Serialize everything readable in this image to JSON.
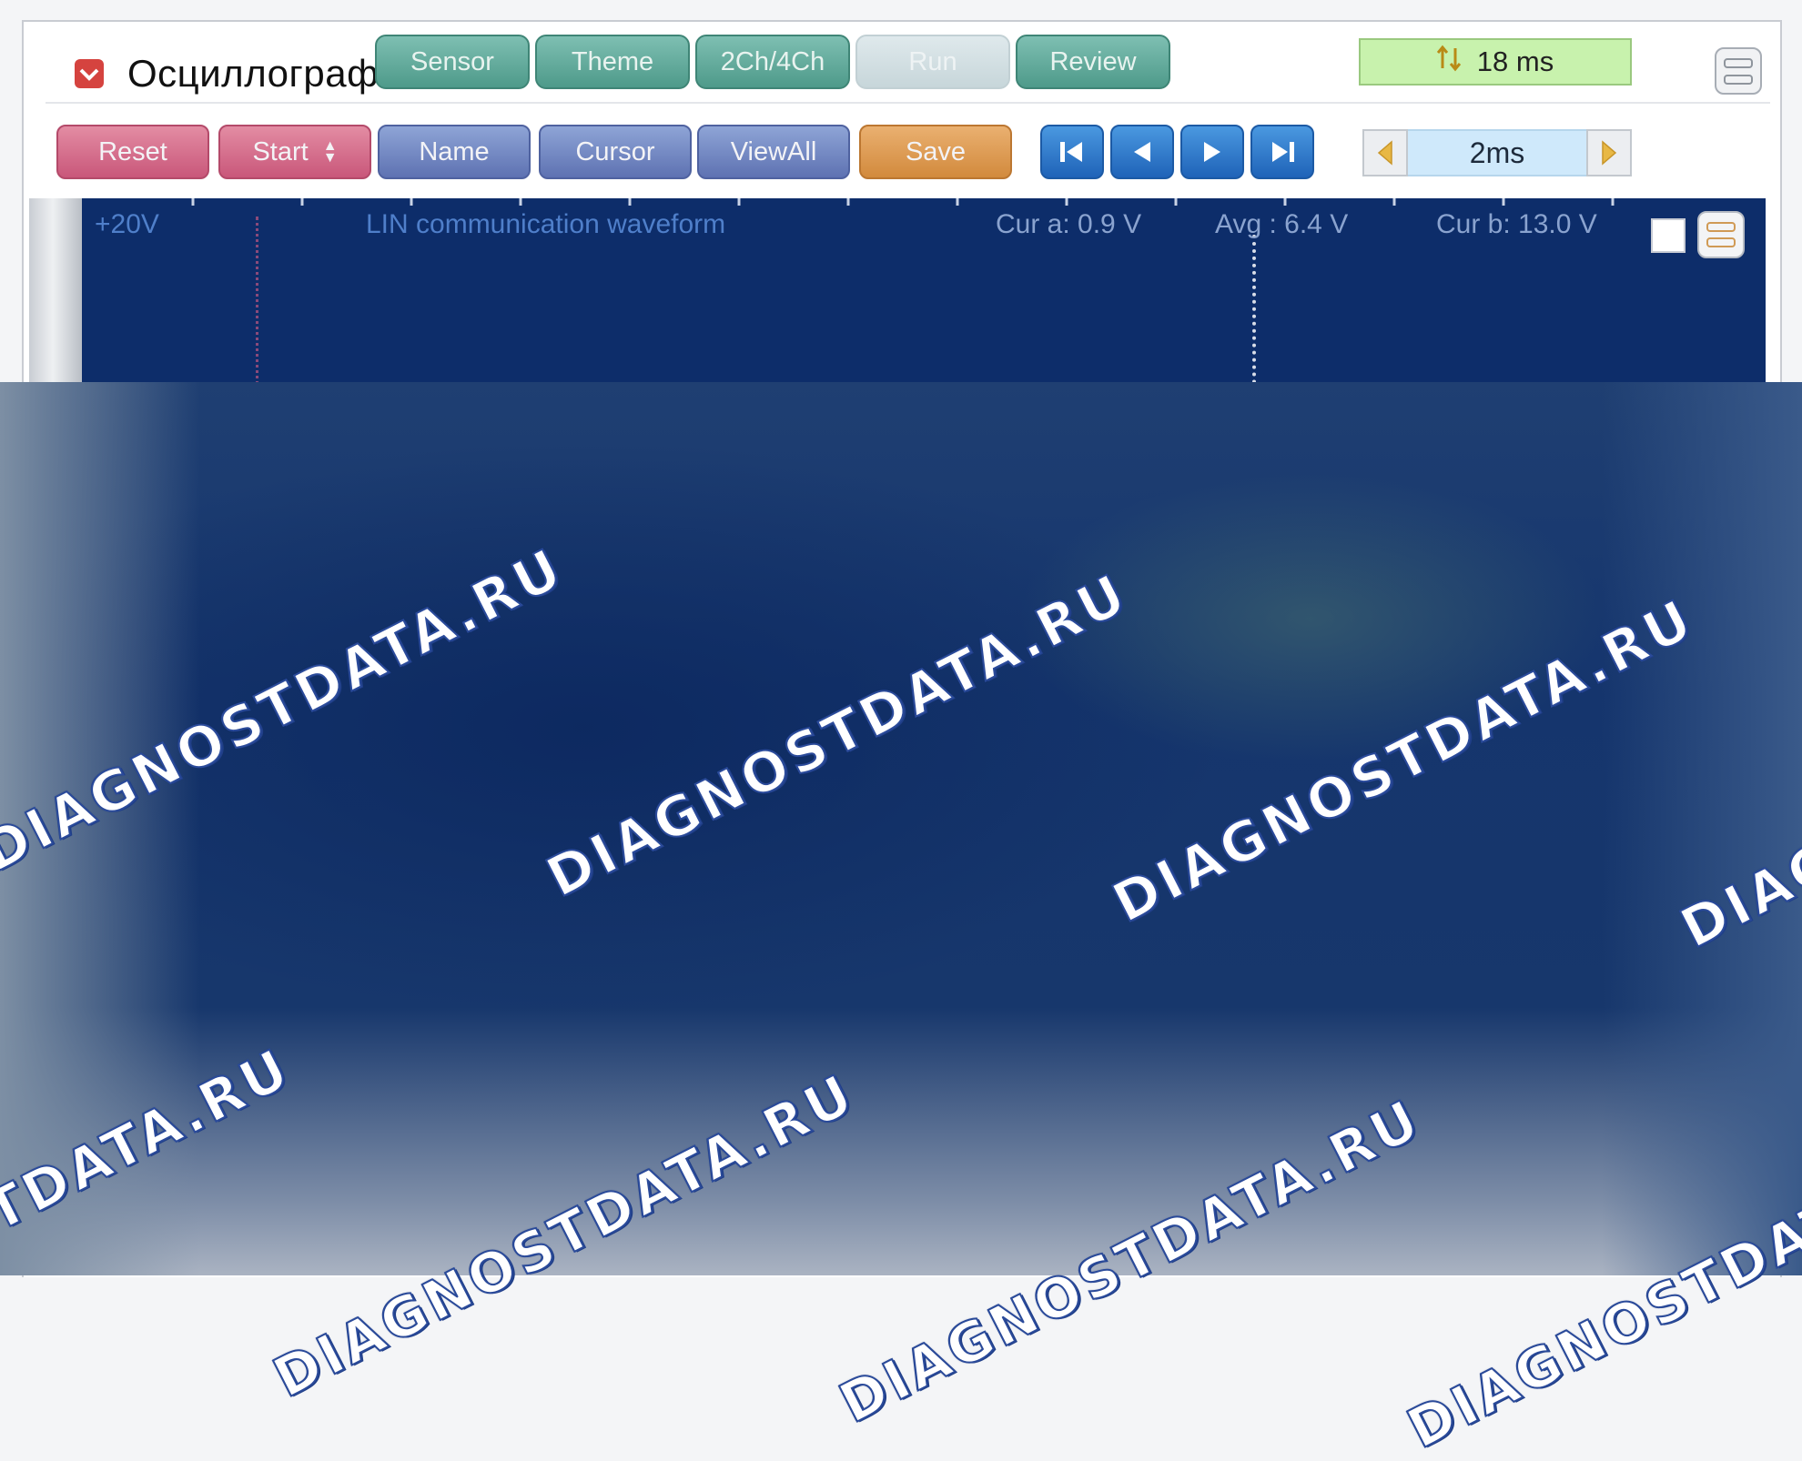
{
  "app": {
    "title": "Осциллограф"
  },
  "tabs": [
    {
      "label": "Sensor",
      "state": "active"
    },
    {
      "label": "Theme",
      "state": "active"
    },
    {
      "label": "2Ch/4Ch",
      "state": "active"
    },
    {
      "label": "Run",
      "state": "disabled"
    },
    {
      "label": "Review",
      "state": "active"
    }
  ],
  "header": {
    "time_readout": "18 ms",
    "time_icon": "sort-icon",
    "menu_icon": "menu-icon"
  },
  "toolbar": {
    "reset": "Reset",
    "start": "Start",
    "name": "Name",
    "cursor": "Cursor",
    "view_all": "ViewAll",
    "save": "Save",
    "nav": [
      "first-icon",
      "prev-icon",
      "next-icon",
      "last-icon"
    ],
    "timebase": "2ms"
  },
  "scope": {
    "voltage_scale": "+20V",
    "waveform_label": "LIN communication waveform",
    "cursor_a": "Cur a: 0.9 V",
    "average": "Avg : 6.4 V",
    "cursor_b": "Cur b: 13.0 V"
  },
  "watermark": "DIAGNOSTDATA.RU",
  "colors": {
    "tab": "#5fa99a",
    "reset_start": "#d46a8a",
    "blue_buttons": "#6d80bf",
    "save": "#dc9a51",
    "nav": "#2f7bcd",
    "scope_bg": "#0d2d6a",
    "time_readout_bg": "#c8f2ad"
  }
}
